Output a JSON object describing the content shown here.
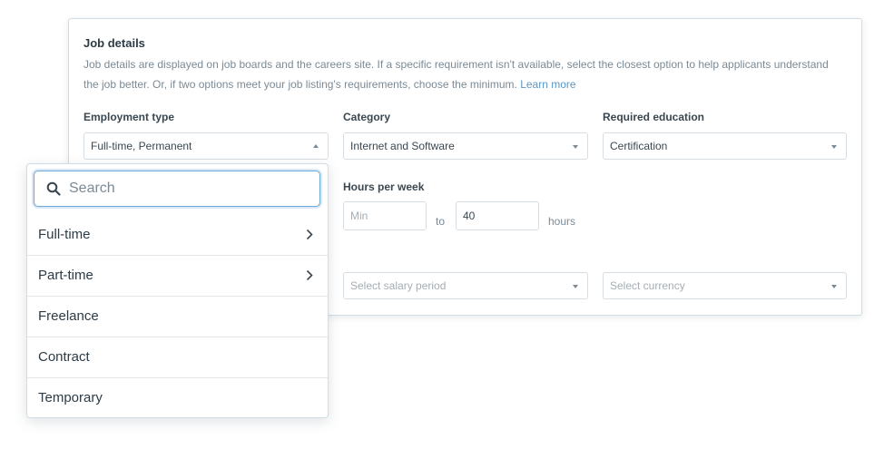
{
  "card": {
    "title": "Job details",
    "description": "Job details are displayed on job boards and the careers site. If a specific requirement isn't available, select the closest option to help applicants understand the job better. Or, if two options meet your job listing's requirements, choose the minimum.",
    "learn_more": "Learn more"
  },
  "employment_type": {
    "label": "Employment type",
    "value": "Full-time, Permanent"
  },
  "category": {
    "label": "Category",
    "value": "Internet and Software"
  },
  "education": {
    "label": "Required education",
    "value": "Certification"
  },
  "hours": {
    "label": "Hours per week",
    "min_placeholder": "Min",
    "to": "to",
    "max_value": "40",
    "unit": "hours"
  },
  "salary_period": {
    "placeholder": "Select salary period"
  },
  "currency": {
    "placeholder": "Select currency"
  },
  "dropdown": {
    "search_placeholder": "Search",
    "options": [
      {
        "label": "Full-time",
        "has_submenu": true
      },
      {
        "label": "Part-time",
        "has_submenu": true
      },
      {
        "label": "Freelance",
        "has_submenu": false
      },
      {
        "label": "Contract",
        "has_submenu": false
      },
      {
        "label": "Temporary",
        "has_submenu": false
      }
    ]
  },
  "colors": {
    "accent": "#6aa8d8",
    "link": "#5a97c7",
    "border": "#cfdde6"
  },
  "icons": [
    "search-icon",
    "chevron-right-icon",
    "caret-down-icon",
    "caret-up-icon"
  ]
}
